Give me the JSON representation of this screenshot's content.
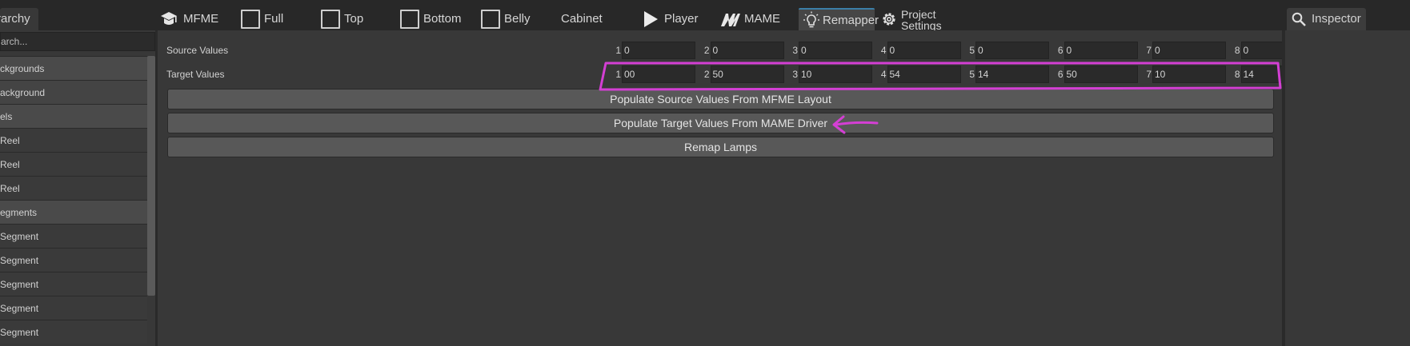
{
  "hierarchy": {
    "tab_label": "rarchy",
    "search_placeholder": "arch...",
    "rows": [
      {
        "label": "ckgrounds",
        "kind": "cat"
      },
      {
        "label": "ackground",
        "kind": "sel"
      },
      {
        "label": "els",
        "kind": "cat"
      },
      {
        "label": "Reel",
        "kind": "item"
      },
      {
        "label": "Reel",
        "kind": "item"
      },
      {
        "label": "Reel",
        "kind": "item"
      },
      {
        "label": "egments",
        "kind": "cat"
      },
      {
        "label": "Segment",
        "kind": "item"
      },
      {
        "label": "Segment",
        "kind": "item"
      },
      {
        "label": "Segment",
        "kind": "item"
      },
      {
        "label": "Segment",
        "kind": "item"
      },
      {
        "label": "Segment",
        "kind": "item"
      }
    ]
  },
  "toolbar": {
    "mfme": "MFME",
    "full": "Full",
    "top": "Top",
    "bottom": "Bottom",
    "belly": "Belly",
    "cabinet": "Cabinet",
    "player": "Player",
    "mame": "MAME",
    "remapper": "Remapper",
    "project_line1": "Project",
    "project_line2": "Settings"
  },
  "inspector": {
    "tab_label": "Inspector"
  },
  "remapper": {
    "source_label": "Source Values",
    "target_label": "Target Values",
    "source": [
      {
        "idx": "1",
        "val": "0"
      },
      {
        "idx": "2",
        "val": "0"
      },
      {
        "idx": "3",
        "val": "0"
      },
      {
        "idx": "4",
        "val": "0"
      },
      {
        "idx": "5",
        "val": "0"
      },
      {
        "idx": "6",
        "val": "0"
      },
      {
        "idx": "7",
        "val": "0"
      },
      {
        "idx": "8",
        "val": "0"
      }
    ],
    "target": [
      {
        "idx": "1",
        "val": "00"
      },
      {
        "idx": "2",
        "val": "50"
      },
      {
        "idx": "3",
        "val": "10"
      },
      {
        "idx": "4",
        "val": "54"
      },
      {
        "idx": "5",
        "val": "14"
      },
      {
        "idx": "6",
        "val": "50"
      },
      {
        "idx": "7",
        "val": "10"
      },
      {
        "idx": "8",
        "val": "14"
      }
    ],
    "btn_populate_source": "Populate Source Values From MFME Layout",
    "btn_populate_target": "Populate Target Values From MAME Driver",
    "btn_remap": "Remap Lamps"
  },
  "colors": {
    "annotation": "#d43fd4",
    "tab_accent": "#3b7fa8"
  }
}
